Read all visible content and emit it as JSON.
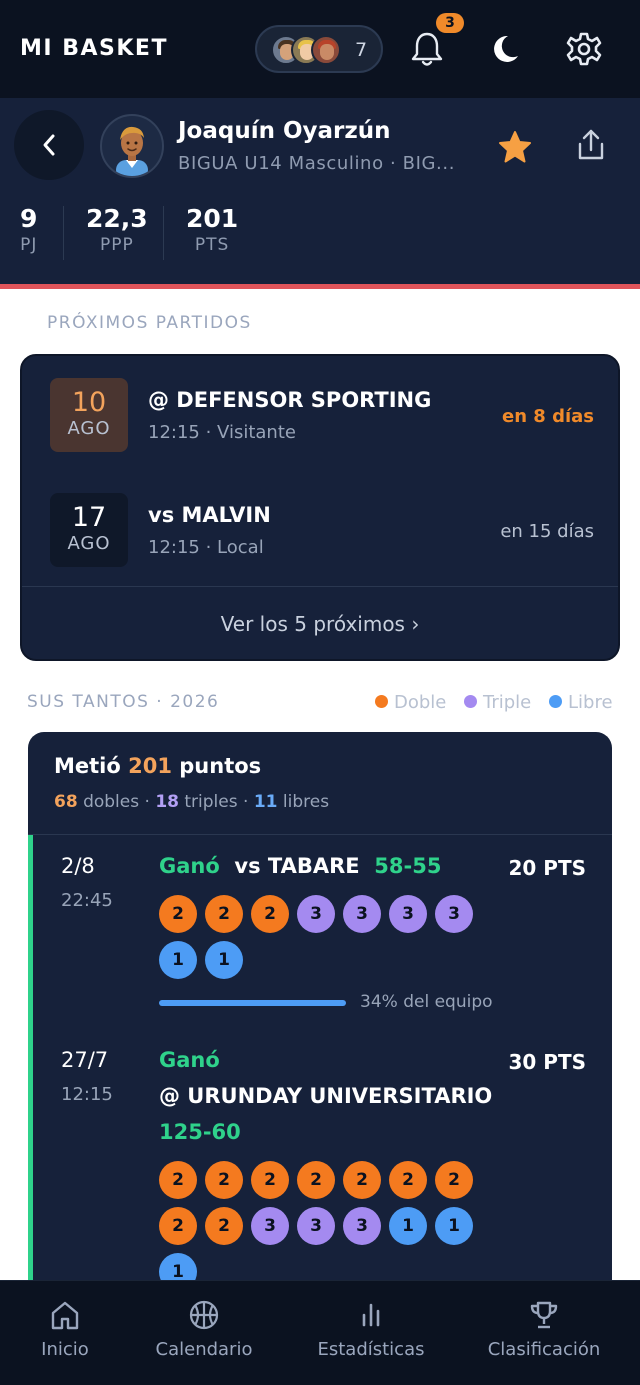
{
  "app": {
    "title": "MI BASKET"
  },
  "topbar": {
    "followers_count": "7",
    "notifications_badge": "3",
    "icons": [
      "bell-icon",
      "moon-icon",
      "gear-icon"
    ]
  },
  "player": {
    "name": "Joaquín Oyarzún",
    "team": "BIGUA U14 Masculino · BIG...",
    "stats": [
      {
        "value": "9",
        "label": "PJ"
      },
      {
        "value": "22,3",
        "label": "PPP"
      },
      {
        "value": "201",
        "label": "PTS"
      }
    ]
  },
  "upcoming": {
    "section_label": "PRÓXIMOS PARTIDOS",
    "games": [
      {
        "day": "10",
        "month": "AGO",
        "opponent": "@ DEFENSOR SPORTING",
        "info": "12:15 · Visitante",
        "when": "en 8 días"
      },
      {
        "day": "17",
        "month": "AGO",
        "opponent": "vs MALVIN",
        "info": "12:15 · Local",
        "when": "en 15 días"
      }
    ],
    "see_more": "Ver los 5 próximos ›"
  },
  "scoring": {
    "section_label": "SUS TANTOS · 2026",
    "legend": [
      {
        "label": "Doble",
        "color": "#f47a1f"
      },
      {
        "label": "Triple",
        "color": "#a48af0"
      },
      {
        "label": "Libre",
        "color": "#4d9cf5"
      }
    ],
    "summary": {
      "prefix": "Metió ",
      "total": "201",
      "suffix": " puntos",
      "doubles": "68",
      "doubles_label": " dobles · ",
      "triples": "18",
      "triples_label": " triples · ",
      "frees": "11",
      "frees_label": " libres"
    },
    "games": [
      {
        "date": "2/8",
        "time": "22:45",
        "result": "Ganó",
        "opponent": "vs TABARE",
        "score": "58-55",
        "points": "20 PTS",
        "shots": [
          "2",
          "2",
          "2",
          "3",
          "3",
          "3",
          "3",
          "1",
          "1"
        ],
        "team_share": 0.34,
        "team_share_label": "34% del equipo"
      },
      {
        "date": "27/7",
        "time": "12:15",
        "result": "Ganó",
        "opponent": "@ URUNDAY UNIVERSITARIO",
        "score": "125-60",
        "points": "30 PTS",
        "shots": [
          "2",
          "2",
          "2",
          "2",
          "2",
          "2",
          "2",
          "2",
          "2",
          "3",
          "3",
          "3",
          "1",
          "1",
          "1"
        ]
      }
    ]
  },
  "nav": [
    {
      "label": "Inicio",
      "icon": "home-icon"
    },
    {
      "label": "Calendario",
      "icon": "basketball-icon"
    },
    {
      "label": "Estadísticas",
      "icon": "stats-icon"
    },
    {
      "label": "Clasificación",
      "icon": "trophy-icon"
    }
  ]
}
